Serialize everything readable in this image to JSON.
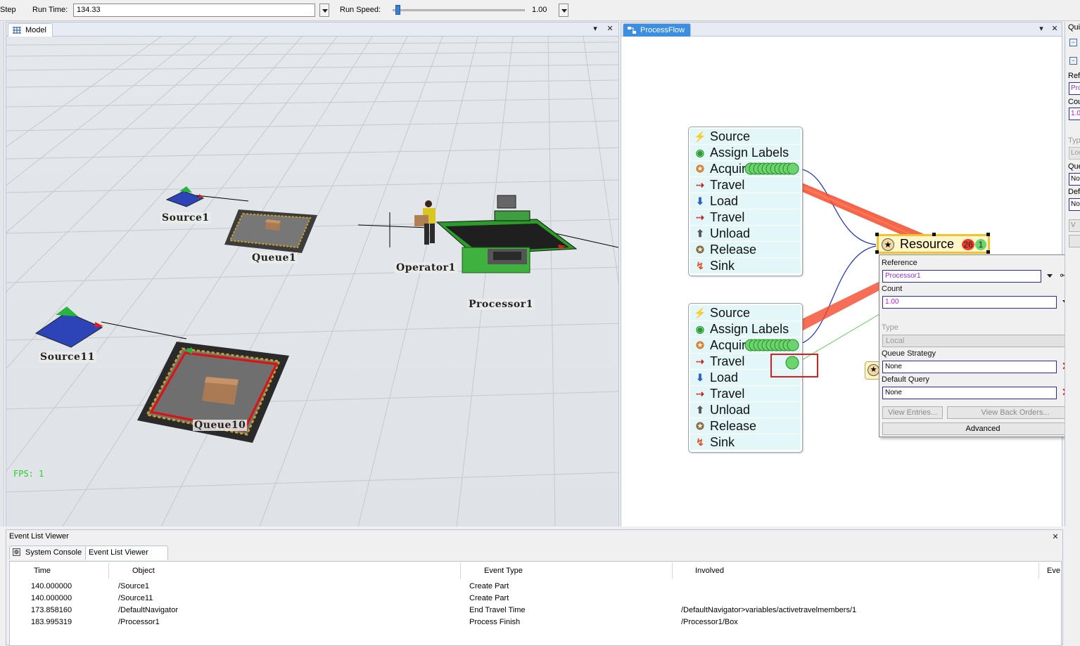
{
  "toolbar": {
    "step_label": "Step",
    "run_time_label": "Run Time:",
    "run_time_value": "134.33",
    "run_speed_label": "Run Speed:",
    "run_speed_value": "1.00",
    "run_speed_fraction": 0.02
  },
  "model": {
    "tab_label": "Model",
    "objects": {
      "source1": "Source1",
      "queue1": "Queue1",
      "operator1": "Operator1",
      "processor1": "Processor1",
      "source11": "Source11",
      "queue10": "Queue10"
    },
    "fps": "FPS: 1"
  },
  "processflow": {
    "tab_label": "ProcessFlow",
    "flow1": [
      {
        "label": "Source",
        "icon": "lightning-icon"
      },
      {
        "label": "Assign Labels",
        "icon": "labels-icon"
      },
      {
        "label": "Acquire",
        "icon": "acquire-icon"
      },
      {
        "label": "Travel",
        "icon": "travel-icon"
      },
      {
        "label": "Load",
        "icon": "load-icon"
      },
      {
        "label": "Travel",
        "icon": "travel-icon"
      },
      {
        "label": "Unload",
        "icon": "unload-icon"
      },
      {
        "label": "Release",
        "icon": "release-icon"
      },
      {
        "label": "Sink",
        "icon": "sink-icon"
      }
    ],
    "flow2": [
      {
        "label": "Source",
        "icon": "lightning-icon"
      },
      {
        "label": "Assign Labels",
        "icon": "labels-icon"
      },
      {
        "label": "Acquire",
        "icon": "acquire-icon"
      },
      {
        "label": "Travel",
        "icon": "travel-icon"
      },
      {
        "label": "Load",
        "icon": "load-icon"
      },
      {
        "label": "Travel",
        "icon": "travel-icon"
      },
      {
        "label": "Unload",
        "icon": "unload-icon"
      },
      {
        "label": "Release",
        "icon": "release-icon"
      },
      {
        "label": "Sink",
        "icon": "sink-icon"
      }
    ],
    "resource": {
      "label": "Resource",
      "red_count": "26",
      "green_count": "1"
    }
  },
  "properties": {
    "reference_label": "Reference",
    "reference_value": "Processor1",
    "count_label": "Count",
    "count_value": "1.00",
    "type_label": "Type",
    "type_value": "Local",
    "queue_strategy_label": "Queue Strategy",
    "queue_strategy_value": "None",
    "default_query_label": "Default Query",
    "default_query_value": "None",
    "view_entries": "View Entries...",
    "view_back_orders": "View Back Orders...",
    "advanced": "Advanced"
  },
  "quick": {
    "title": "Qui",
    "ref": "Ref",
    "ref_val": "Pro",
    "cou": "Cou",
    "cou_val": "1.0",
    "typ": "Typ",
    "typ_val": "Loc",
    "que": "Que",
    "que_val": "Nor",
    "def": "Def",
    "def_val": "Nor",
    "btn": "V"
  },
  "event_list": {
    "title": "Event List Viewer",
    "tabs": [
      "System Console",
      "Event List Viewer"
    ],
    "columns": [
      "Time",
      "Object",
      "Event Type",
      "Involved",
      "Eve"
    ],
    "rows": [
      {
        "time": "140.000000",
        "object": "/Source1",
        "event": "Create Part",
        "involved": ""
      },
      {
        "time": "140.000000",
        "object": "/Source11",
        "event": "Create Part",
        "involved": ""
      },
      {
        "time": "173.858160",
        "object": "/DefaultNavigator",
        "event": "End Travel Time",
        "involved": "/DefaultNavigator>variables/activetravelmembers/1"
      },
      {
        "time": "183.995319",
        "object": "/Processor1",
        "event": "Process Finish",
        "involved": "/Processor1/Box"
      }
    ]
  }
}
